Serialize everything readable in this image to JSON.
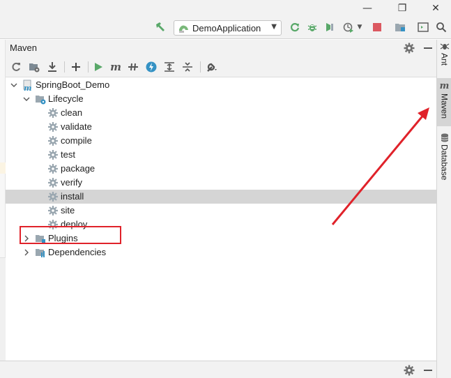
{
  "window": {
    "controls": {
      "minimize": "—",
      "restore": "❐",
      "close": "✕"
    }
  },
  "toolbar": {
    "run_config_label": "DemoApplication",
    "icons": [
      "hammer-icon",
      "run-config-icon",
      "rerun-icon",
      "debug-icon",
      "profiler-icon",
      "stop-icon",
      "project-structure-icon",
      "terminal-icon",
      "search-icon"
    ]
  },
  "maven_panel": {
    "title": "Maven",
    "toolbar_icons": [
      "reload-icon",
      "generate-sources-icon",
      "download-icon",
      "add-icon",
      "run-icon",
      "maven-goal-icon",
      "toggle-offline-icon",
      "skip-tests-icon",
      "show-dependencies-icon",
      "collapse-all-icon",
      "settings-wrench-icon"
    ],
    "tree": {
      "root": "SpringBoot_Demo",
      "lifecycle": {
        "label": "Lifecycle",
        "items": [
          "clean",
          "validate",
          "compile",
          "test",
          "package",
          "verify",
          "install",
          "site",
          "deploy"
        ],
        "selected": "install"
      },
      "plugins": "Plugins",
      "dependencies": "Dependencies"
    }
  },
  "right_stripe": {
    "tabs": [
      {
        "label": "Ant",
        "icon": "ant-icon",
        "active": false
      },
      {
        "label": "Maven",
        "icon": "maven-icon",
        "active": true
      },
      {
        "label": "Database",
        "icon": "database-icon",
        "active": false
      }
    ]
  },
  "colors": {
    "accent_green": "#59a869",
    "stop_red": "#db5860",
    "annotation_red": "#e0222a",
    "selection_gray": "#d5d5d5",
    "maven_blue": "#3592c4"
  }
}
